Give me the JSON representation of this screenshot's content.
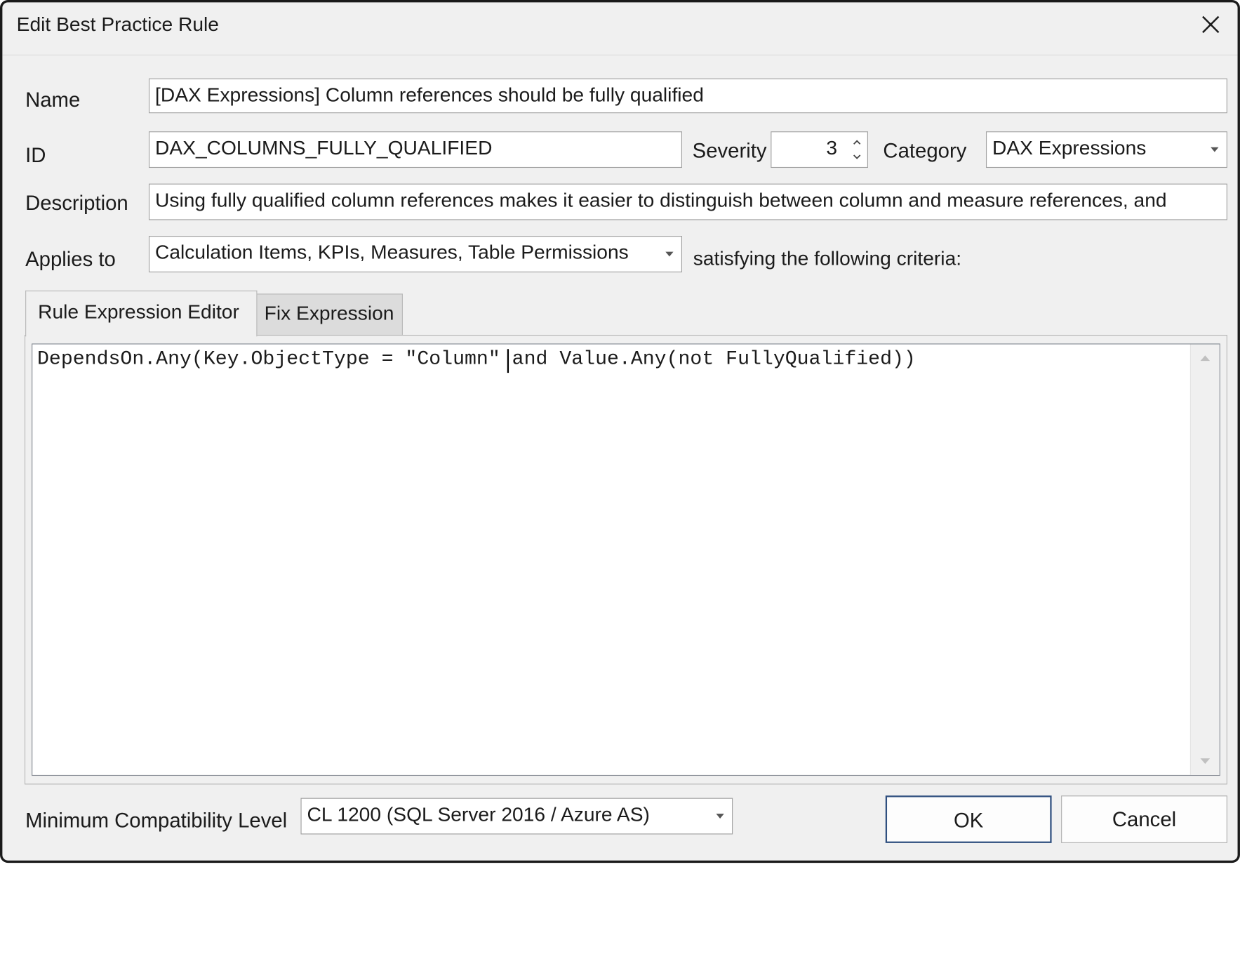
{
  "dialog": {
    "title": "Edit Best Practice Rule"
  },
  "form": {
    "name_label": "Name",
    "name_value": "[DAX Expressions] Column references should be fully qualified",
    "id_label": "ID",
    "id_value": "DAX_COLUMNS_FULLY_QUALIFIED",
    "severity_label": "Severity",
    "severity_value": "3",
    "category_label": "Category",
    "category_value": "DAX Expressions",
    "description_label": "Description",
    "description_value": "Using fully qualified column references makes it easier to distinguish between column and measure references, and",
    "applies_to_label": "Applies to",
    "applies_to_value": "Calculation Items, KPIs, Measures, Table Permissions",
    "criteria_text": "satisfying the following criteria:"
  },
  "tabs": [
    {
      "label": "Rule Expression Editor",
      "active": true
    },
    {
      "label": "Fix Expression",
      "active": false
    }
  ],
  "editor": {
    "code": "DependsOn.Any(Key.ObjectType = \"Column\" and Value.Any(not FullyQualified))"
  },
  "footer": {
    "compat_label": "Minimum Compatibility Level",
    "compat_value": "CL 1200 (SQL Server 2016 / Azure AS)",
    "ok_label": "OK",
    "cancel_label": "Cancel"
  },
  "icons": [
    "close-icon",
    "dropdown-arrow-icon",
    "spin-up-icon",
    "spin-down-icon",
    "scroll-up-icon",
    "scroll-down-icon"
  ]
}
